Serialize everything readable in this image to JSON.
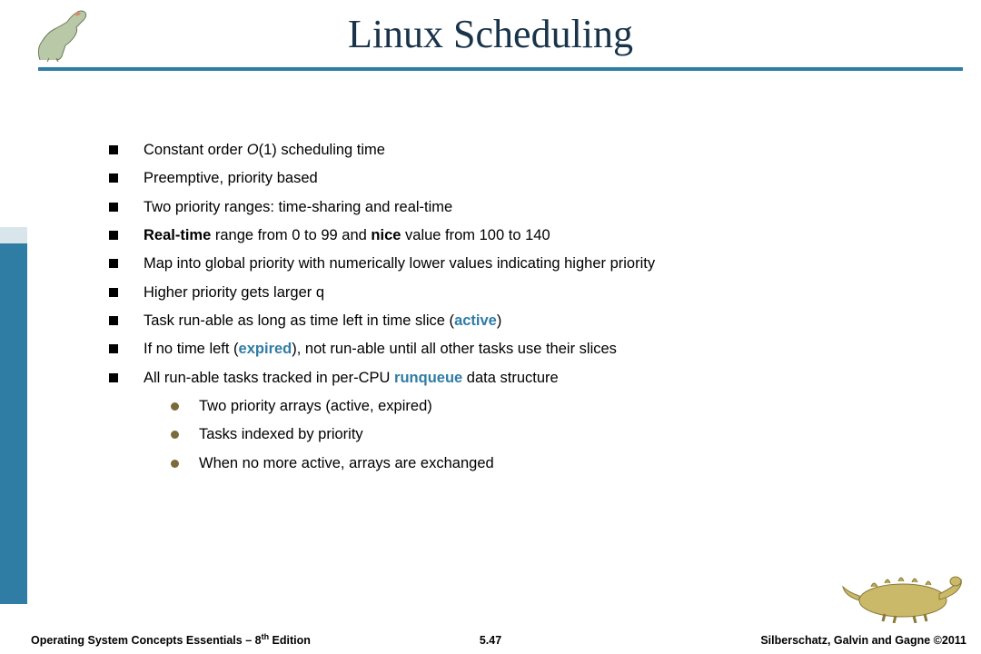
{
  "title": "Linux Scheduling",
  "bullets": {
    "b0_a": "Constant order ",
    "b0_b": "O",
    "b0_c": "(1) scheduling time",
    "b1": "Preemptive, priority based",
    "b2": "Two priority ranges: time-sharing and real-time",
    "b3_a": "Real-time",
    "b3_b": " range from 0 to 99 and ",
    "b3_c": "nice",
    "b3_d": " value from 100 to 140",
    "b4": "Map into  global priority with numerically lower values indicating higher priority",
    "b5": "Higher priority gets larger q",
    "b6_a": "Task run-able as long as time left in time slice (",
    "b6_b": "active",
    "b6_c": ")",
    "b7_a": "If no time left (",
    "b7_b": "expired",
    "b7_c": "), not run-able until all other tasks use their slices",
    "b8_a": "All run-able tasks tracked in per-CPU ",
    "b8_b": "runqueue",
    "b8_c": " data structure",
    "s0": "Two priority arrays (active, expired)",
    "s1": "Tasks indexed by priority",
    "s2": "When no more active, arrays are exchanged"
  },
  "footer": {
    "left_a": "Operating System Concepts Essentials – 8",
    "left_b": "th",
    "left_c": " Edition",
    "center": "5.47",
    "right": "Silberschatz, Galvin and Gagne ©2011"
  }
}
